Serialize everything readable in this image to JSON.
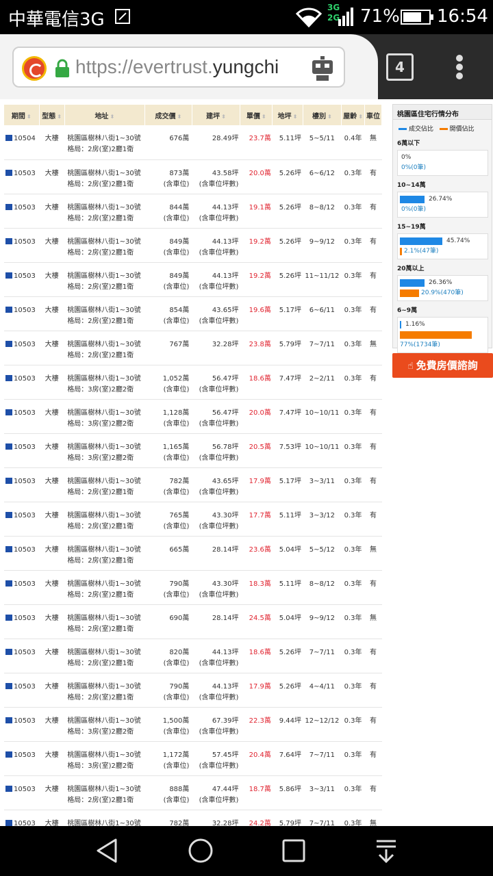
{
  "status_bar": {
    "carrier": "中華電信3G",
    "network_top": "3G",
    "network_bottom": "2G",
    "battery_percent": "71%",
    "battery_level": 0.71,
    "time": "16:54"
  },
  "browser": {
    "url_prefix": "https://evertrust.",
    "url_domain": "yungchi",
    "tab_count": "4"
  },
  "table": {
    "headers": [
      "期間",
      "型態",
      "地址",
      "成交價",
      "建坪",
      "單價",
      "地坪",
      "樓別",
      "屋齡",
      "車位"
    ],
    "rows": [
      {
        "period": "10504",
        "type": "大樓",
        "addr1": "桃園區樹林八街1~30號",
        "addr2": "格局：2房(室)2廳1衛",
        "price": "676萬",
        "price_note": "",
        "area": "28.49坪",
        "area_note": "",
        "unit": "23.7萬",
        "land": "5.11坪",
        "floor": "5~5/11",
        "age": "0.4年",
        "parking": "無"
      },
      {
        "period": "10503",
        "type": "大樓",
        "addr1": "桃園區樹林八街1~30號",
        "addr2": "格局：2房(室)2廳1衛",
        "price": "873萬",
        "price_note": "(含車位)",
        "area": "43.58坪",
        "area_note": "(含車位坪數)",
        "unit": "20.0萬",
        "land": "5.26坪",
        "floor": "6~6/12",
        "age": "0.3年",
        "parking": "有"
      },
      {
        "period": "10503",
        "type": "大樓",
        "addr1": "桃園區樹林八街1~30號",
        "addr2": "格局：2房(室)2廳1衛",
        "price": "844萬",
        "price_note": "(含車位)",
        "area": "44.13坪",
        "area_note": "(含車位坪數)",
        "unit": "19.1萬",
        "land": "5.26坪",
        "floor": "8~8/12",
        "age": "0.3年",
        "parking": "有"
      },
      {
        "period": "10503",
        "type": "大樓",
        "addr1": "桃園區樹林八街1~30號",
        "addr2": "格局：2房(室)2廳1衛",
        "price": "849萬",
        "price_note": "(含車位)",
        "area": "44.13坪",
        "area_note": "(含車位坪數)",
        "unit": "19.2萬",
        "land": "5.26坪",
        "floor": "9~9/12",
        "age": "0.3年",
        "parking": "有"
      },
      {
        "period": "10503",
        "type": "大樓",
        "addr1": "桃園區樹林八街1~30號",
        "addr2": "格局：2房(室)2廳1衛",
        "price": "849萬",
        "price_note": "(含車位)",
        "area": "44.13坪",
        "area_note": "(含車位坪數)",
        "unit": "19.2萬",
        "land": "5.26坪",
        "floor": "11~11/12",
        "age": "0.3年",
        "parking": "有"
      },
      {
        "period": "10503",
        "type": "大樓",
        "addr1": "桃園區樹林八街1~30號",
        "addr2": "格局：2房(室)2廳1衛",
        "price": "854萬",
        "price_note": "(含車位)",
        "area": "43.65坪",
        "area_note": "(含車位坪數)",
        "unit": "19.6萬",
        "land": "5.17坪",
        "floor": "6~6/11",
        "age": "0.3年",
        "parking": "有"
      },
      {
        "period": "10503",
        "type": "大樓",
        "addr1": "桃園區樹林八街1~30號",
        "addr2": "格局：2房(室)2廳1衛",
        "price": "767萬",
        "price_note": "",
        "area": "32.28坪",
        "area_note": "",
        "unit": "23.8萬",
        "land": "5.79坪",
        "floor": "7~7/11",
        "age": "0.3年",
        "parking": "無"
      },
      {
        "period": "10503",
        "type": "大樓",
        "addr1": "桃園區樹林八街1~30號",
        "addr2": "格局：3房(室)2廳2衛",
        "price": "1,052萬",
        "price_note": "(含車位)",
        "area": "56.47坪",
        "area_note": "(含車位坪數)",
        "unit": "18.6萬",
        "land": "7.47坪",
        "floor": "2~2/11",
        "age": "0.3年",
        "parking": "有"
      },
      {
        "period": "10503",
        "type": "大樓",
        "addr1": "桃園區樹林八街1~30號",
        "addr2": "格局：3房(室)2廳2衛",
        "price": "1,128萬",
        "price_note": "(含車位)",
        "area": "56.47坪",
        "area_note": "(含車位坪數)",
        "unit": "20.0萬",
        "land": "7.47坪",
        "floor": "10~10/11",
        "age": "0.3年",
        "parking": "有"
      },
      {
        "period": "10503",
        "type": "大樓",
        "addr1": "桃園區樹林八街1~30號",
        "addr2": "格局：3房(室)2廳2衛",
        "price": "1,165萬",
        "price_note": "(含車位)",
        "area": "56.78坪",
        "area_note": "(含車位坪數)",
        "unit": "20.5萬",
        "land": "7.53坪",
        "floor": "10~10/11",
        "age": "0.3年",
        "parking": "有"
      },
      {
        "period": "10503",
        "type": "大樓",
        "addr1": "桃園區樹林八街1~30號",
        "addr2": "格局：2房(室)2廳1衛",
        "price": "782萬",
        "price_note": "(含車位)",
        "area": "43.65坪",
        "area_note": "(含車位坪數)",
        "unit": "17.9萬",
        "land": "5.17坪",
        "floor": "3~3/11",
        "age": "0.3年",
        "parking": "有"
      },
      {
        "period": "10503",
        "type": "大樓",
        "addr1": "桃園區樹林八街1~30號",
        "addr2": "格局：2房(室)2廳1衛",
        "price": "765萬",
        "price_note": "(含車位)",
        "area": "43.30坪",
        "area_note": "(含車位坪數)",
        "unit": "17.7萬",
        "land": "5.11坪",
        "floor": "3~3/12",
        "age": "0.3年",
        "parking": "有"
      },
      {
        "period": "10503",
        "type": "大樓",
        "addr1": "桃園區樹林八街1~30號",
        "addr2": "格局：2房(室)2廳1衛",
        "price": "665萬",
        "price_note": "",
        "area": "28.14坪",
        "area_note": "",
        "unit": "23.6萬",
        "land": "5.04坪",
        "floor": "5~5/12",
        "age": "0.3年",
        "parking": "無"
      },
      {
        "period": "10503",
        "type": "大樓",
        "addr1": "桃園區樹林八街1~30號",
        "addr2": "格局：2房(室)2廳1衛",
        "price": "790萬",
        "price_note": "(含車位)",
        "area": "43.30坪",
        "area_note": "(含車位坪數)",
        "unit": "18.3萬",
        "land": "5.11坪",
        "floor": "8~8/12",
        "age": "0.3年",
        "parking": "有"
      },
      {
        "period": "10503",
        "type": "大樓",
        "addr1": "桃園區樹林八街1~30號",
        "addr2": "格局：2房(室)2廳1衛",
        "price": "690萬",
        "price_note": "",
        "area": "28.14坪",
        "area_note": "",
        "unit": "24.5萬",
        "land": "5.04坪",
        "floor": "9~9/12",
        "age": "0.3年",
        "parking": "無"
      },
      {
        "period": "10503",
        "type": "大樓",
        "addr1": "桃園區樹林八街1~30號",
        "addr2": "格局：2房(室)2廳1衛",
        "price": "820萬",
        "price_note": "(含車位)",
        "area": "44.13坪",
        "area_note": "(含車位坪數)",
        "unit": "18.6萬",
        "land": "5.26坪",
        "floor": "7~7/11",
        "age": "0.3年",
        "parking": "有"
      },
      {
        "period": "10503",
        "type": "大樓",
        "addr1": "桃園區樹林八街1~30號",
        "addr2": "格局：2房(室)2廳1衛",
        "price": "790萬",
        "price_note": "(含車位)",
        "area": "44.13坪",
        "area_note": "(含車位坪數)",
        "unit": "17.9萬",
        "land": "5.26坪",
        "floor": "4~4/11",
        "age": "0.3年",
        "parking": "有"
      },
      {
        "period": "10503",
        "type": "大樓",
        "addr1": "桃園區樹林八街1~30號",
        "addr2": "格局：3房(室)2廳2衛",
        "price": "1,500萬",
        "price_note": "(含車位)",
        "area": "67.39坪",
        "area_note": "(含車位坪數)",
        "unit": "22.3萬",
        "land": "9.44坪",
        "floor": "12~12/12",
        "age": "0.3年",
        "parking": "有"
      },
      {
        "period": "10503",
        "type": "大樓",
        "addr1": "桃園區樹林八街1~30號",
        "addr2": "格局：3房(室)2廳2衛",
        "price": "1,172萬",
        "price_note": "(含車位)",
        "area": "57.45坪",
        "area_note": "(含車位坪數)",
        "unit": "20.4萬",
        "land": "7.64坪",
        "floor": "7~7/11",
        "age": "0.3年",
        "parking": "有"
      },
      {
        "period": "10503",
        "type": "大樓",
        "addr1": "桃園區樹林八街1~30號",
        "addr2": "格局：2房(室)2廳1衛",
        "price": "888萬",
        "price_note": "(含車位)",
        "area": "47.44坪",
        "area_note": "(含車位坪數)",
        "unit": "18.7萬",
        "land": "5.86坪",
        "floor": "3~3/11",
        "age": "0.3年",
        "parking": "有"
      },
      {
        "period": "10503",
        "type": "大樓",
        "addr1": "桃園區樹林八街1~30號",
        "addr2": "",
        "price": "782萬",
        "price_note": "",
        "area": "32.28坪",
        "area_note": "",
        "unit": "24.2萬",
        "land": "5.79坪",
        "floor": "7~7/11",
        "age": "0.3年",
        "parking": "無"
      }
    ]
  },
  "side_panel": {
    "title": "桃園區住宅行情分布",
    "legend_deal": "成交佔比",
    "legend_ask": "開價佔比",
    "color_deal": "#1e88e5",
    "color_ask": "#f57c00",
    "groups": [
      {
        "label": "6萬以下",
        "deal_text": "0%",
        "deal_pct": 0,
        "ask_text": "0%(0筆)",
        "ask_pct": 0
      },
      {
        "label": "10~14萬",
        "deal_text": "26.74%",
        "deal_pct": 26.74,
        "ask_text": "0%(0筆)",
        "ask_pct": 0
      },
      {
        "label": "15~19萬",
        "deal_text": "45.74%",
        "deal_pct": 45.74,
        "ask_text": "2.1%(47筆)",
        "ask_pct": 2.1
      },
      {
        "label": "20萬以上",
        "deal_text": "26.36%",
        "deal_pct": 26.36,
        "ask_text": "20.9%(470筆)",
        "ask_pct": 20.9
      },
      {
        "label": "6~9萬",
        "deal_text": "1.16%",
        "deal_pct": 1.16,
        "ask_text": "77%(1734筆)",
        "ask_pct": 77
      }
    ]
  },
  "cta": {
    "label": "免費房價諮詢"
  }
}
